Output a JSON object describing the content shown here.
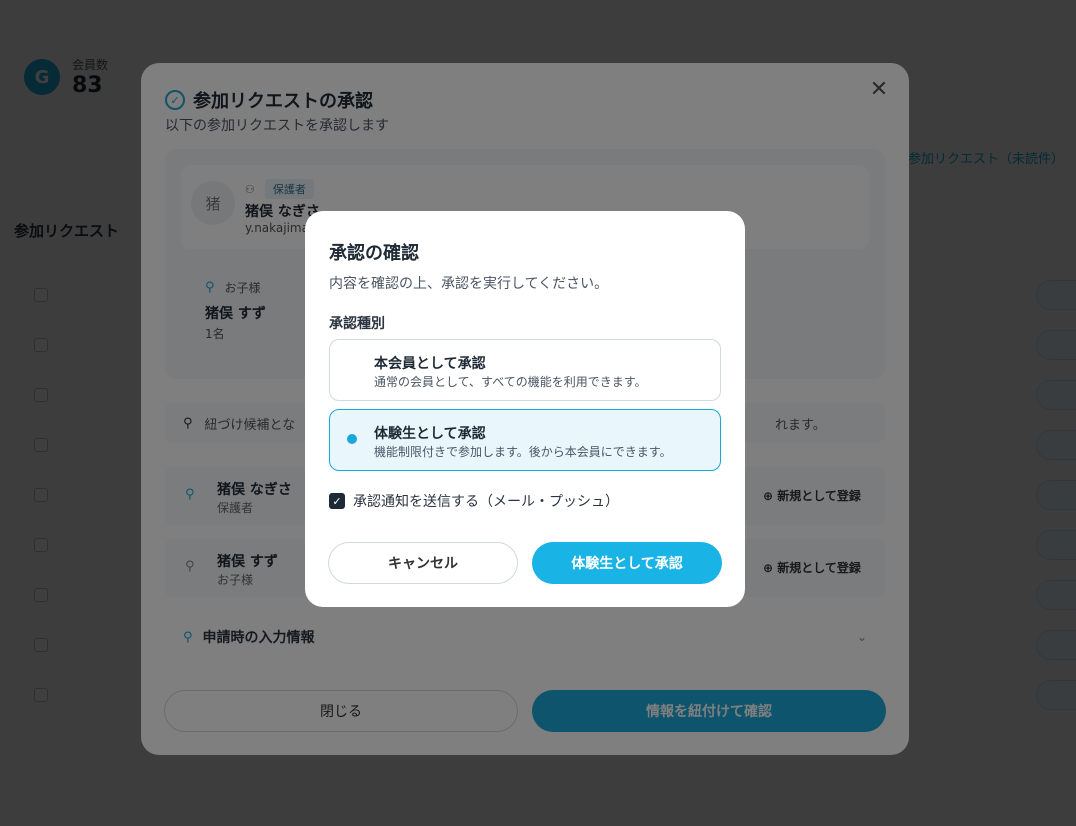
{
  "background": {
    "stat_icon": "G",
    "stat_label": "会員数",
    "stat_value": "83",
    "section_title": "参加リクエスト",
    "right_label": "参加リクエスト（未読件）"
  },
  "request_modal": {
    "title": "参加リクエストの承認",
    "subtitle": "以下の参加リクエストを承認します",
    "close_icon": "close-icon",
    "guardian": {
      "avatar": "猪",
      "role_badge": "保護者",
      "name": "猪俣 なぎさ",
      "email": "y.nakajima"
    },
    "child": {
      "role": "お子様",
      "name": "猪俣 すず",
      "count": "1名"
    },
    "hint_text": "紐づけ候補とな",
    "hint_tail": "れます。",
    "candidates": [
      {
        "name": "猪俣 なぎさ",
        "role": "保護者",
        "action": "新規として登録"
      },
      {
        "name": "猪俣 すず",
        "role": "お子様",
        "action": "新規として登録"
      }
    ],
    "accordion_label": "申請時の入力情報",
    "close_button": "閉じる",
    "confirm_button": "情報を紐付けて確認"
  },
  "confirm_dialog": {
    "title": "承認の確認",
    "description": "内容を確認の上、承認を実行してください。",
    "section_label": "承認種別",
    "options": [
      {
        "title": "本会員として承認",
        "description": "通常の会員として、すべての機能を利用できます。",
        "selected": false
      },
      {
        "title": "体験生として承認",
        "description": "機能制限付きで参加します。後から本会員にできます。",
        "selected": true
      }
    ],
    "notify_checkbox": {
      "label": "承認通知を送信する（メール・プッシュ）",
      "checked": true
    },
    "cancel_button": "キャンセル",
    "approve_button": "体験生として承認"
  },
  "colors": {
    "accent": "#1aa8d8",
    "overlay": "rgba(0,0,0,0.5)"
  }
}
